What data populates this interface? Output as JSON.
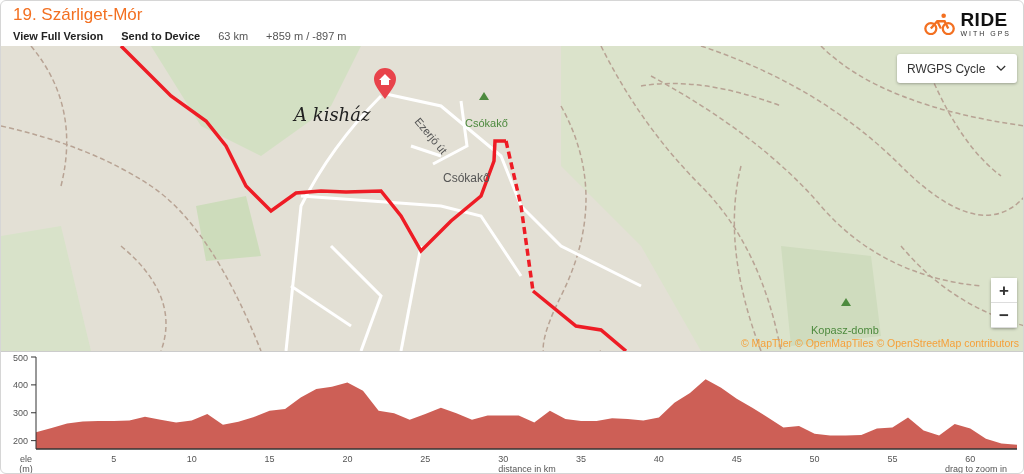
{
  "header": {
    "title": "19. Szárliget-Mór",
    "links": [
      "View Full Version",
      "Send to Device"
    ],
    "distance": "63 km",
    "elevation_gain": "+859 m / -897 m",
    "logo": {
      "word": "RIDE",
      "tagline": "WITH GPS"
    }
  },
  "map": {
    "layer_select": {
      "value": "RWGPS Cycle"
    },
    "zoom_in": "+",
    "zoom_out": "−",
    "labels": [
      {
        "text": "A kisház",
        "kind": "marker"
      },
      {
        "text": "Ezerjó út",
        "kind": "street"
      },
      {
        "text": "Csókakő",
        "kind": "peak"
      },
      {
        "text": "Csókakő",
        "kind": "town"
      },
      {
        "text": "Kopasz-domb",
        "kind": "peak"
      }
    ],
    "attribution": "© MapTiler © OpenMapTiles © OpenStreetMap contributors"
  },
  "elevation": {
    "ylabel": [
      "ele",
      "(m)"
    ],
    "xlabel": "distance in km",
    "hint": "drag to zoom in",
    "chart_data": {
      "type": "area",
      "xlim": [
        0,
        63
      ],
      "ylim": [
        170,
        500
      ],
      "xticks": [
        5,
        10,
        15,
        20,
        25,
        30,
        35,
        40,
        45,
        50,
        55,
        60
      ],
      "yticks": [
        200,
        300,
        400,
        500
      ],
      "x": [
        0,
        1,
        2,
        3,
        4,
        5,
        6,
        7,
        8,
        9,
        10,
        11,
        12,
        13,
        14,
        15,
        16,
        17,
        18,
        19,
        20,
        21,
        22,
        23,
        24,
        25,
        26,
        27,
        28,
        29,
        30,
        31,
        32,
        33,
        34,
        35,
        36,
        37,
        38,
        39,
        40,
        41,
        42,
        43,
        44,
        45,
        46,
        47,
        48,
        49,
        50,
        51,
        52,
        53,
        54,
        55,
        56,
        57,
        58,
        59,
        60,
        61,
        62,
        63
      ],
      "series": [
        {
          "color": "#cd5f56",
          "values": [
            230,
            245,
            262,
            269,
            270,
            270,
            272,
            286,
            275,
            265,
            272,
            296,
            257,
            268,
            285,
            307,
            314,
            355,
            385,
            393,
            408,
            379,
            307,
            298,
            275,
            296,
            318,
            298,
            275,
            290,
            290,
            290,
            265,
            307,
            278,
            270,
            270,
            280,
            278,
            272,
            283,
            336,
            371,
            420,
            390,
            350,
            318,
            283,
            247,
            253,
            225,
            218,
            218,
            220,
            243,
            247,
            283,
            236,
            218,
            260,
            243,
            207,
            190,
            185
          ]
        }
      ]
    }
  }
}
